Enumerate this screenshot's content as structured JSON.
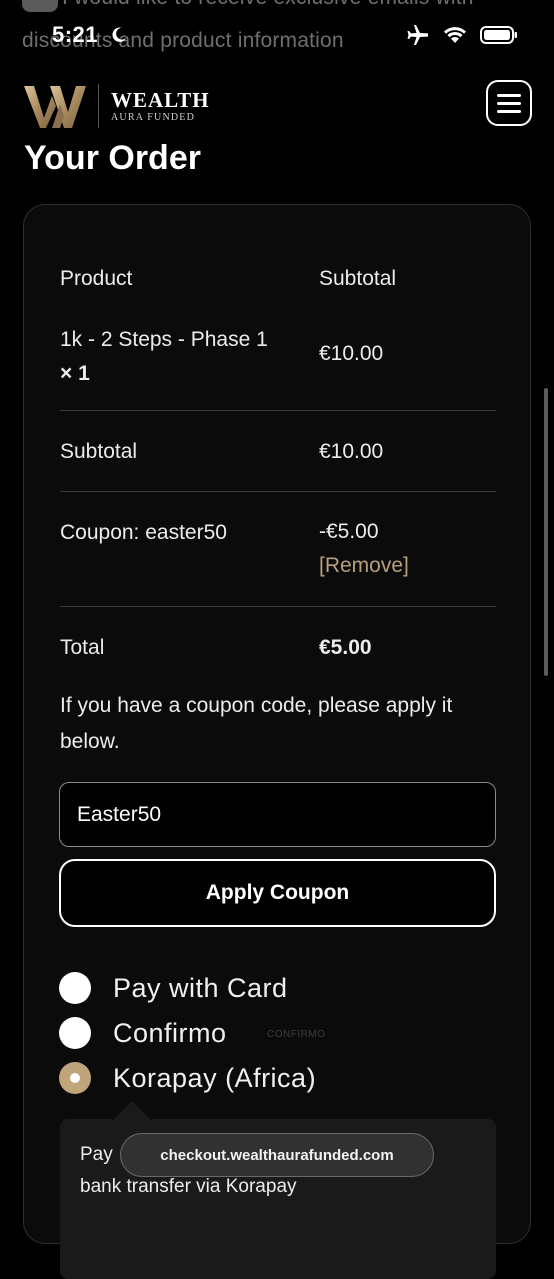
{
  "status_bar": {
    "time": "5:21",
    "behind_text_line1": "I would like to receive exclusive emails with",
    "behind_text_line2": "discounts and product information"
  },
  "header": {
    "logo_word1": "WEALTH",
    "logo_word2": "AURA FUNDED",
    "menu_icon": "hamburger-icon"
  },
  "page": {
    "title": "Your Order"
  },
  "order": {
    "col_product": "Product",
    "col_subtotal": "Subtotal",
    "item_name": "1k - 2 Steps - Phase 1",
    "item_qty": "× 1",
    "item_price": "€10.00",
    "subtotal_label": "Subtotal",
    "subtotal_value": "€10.00",
    "coupon_label": "Coupon: easter50",
    "coupon_value": "-€5.00",
    "coupon_remove": "[Remove]",
    "total_label": "Total",
    "total_value": "€5.00"
  },
  "coupon": {
    "note": "If you have a coupon code, please apply it below.",
    "input_value": "Easter50",
    "apply_label": "Apply Coupon"
  },
  "payment": {
    "options": [
      {
        "label": "Pay with Card",
        "selected": false
      },
      {
        "label": "Confirmo",
        "selected": false
      },
      {
        "label": "Korapay (Africa)",
        "selected": true
      }
    ],
    "confirmo_badge": "CONFIRMO",
    "desc_start": "Pay",
    "desc_line2": "bank transfer via Korapay"
  },
  "browser": {
    "url": "checkout.wealthaurafunded.com"
  },
  "colors": {
    "accent_gold": "#c0a57a",
    "remove_link": "#b8a07a",
    "background": "#000000"
  }
}
